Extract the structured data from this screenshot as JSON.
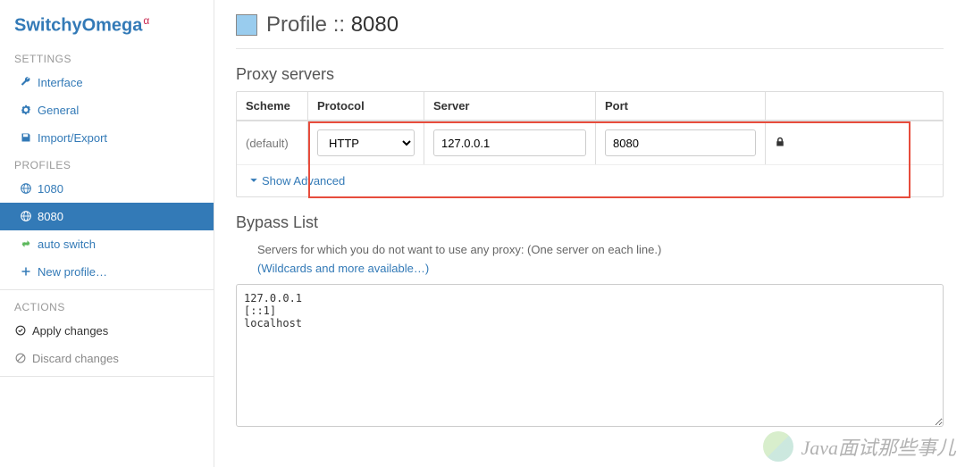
{
  "brand": {
    "name": "SwitchyOmega",
    "sup": "α"
  },
  "sidebar": {
    "settings_hdr": "SETTINGS",
    "settings": [
      {
        "label": "Interface"
      },
      {
        "label": "General"
      },
      {
        "label": "Import/Export"
      }
    ],
    "profiles_hdr": "PROFILES",
    "profiles": [
      {
        "label": "1080"
      },
      {
        "label": "8080"
      },
      {
        "label": "auto switch"
      }
    ],
    "new_profile_label": "New profile…",
    "actions_hdr": "ACTIONS",
    "apply_label": "Apply changes",
    "discard_label": "Discard changes"
  },
  "page": {
    "title_prefix": "Profile :: ",
    "profile_name": "8080",
    "proxy_servers_hdr": "Proxy servers",
    "table": {
      "scheme_hdr": "Scheme",
      "protocol_hdr": "Protocol",
      "server_hdr": "Server",
      "port_hdr": "Port",
      "scheme_default": "(default)",
      "protocol_value": "HTTP",
      "server_value": "127.0.0.1",
      "port_value": "8080"
    },
    "show_advanced": "Show Advanced",
    "bypass_hdr": "Bypass List",
    "bypass_desc": "Servers for which you do not want to use any proxy: (One server on each line.)",
    "bypass_link": "(Wildcards and more available…)",
    "bypass_text": "127.0.0.1\n[::1]\nlocalhost"
  },
  "watermark": "Java面试那些事儿"
}
